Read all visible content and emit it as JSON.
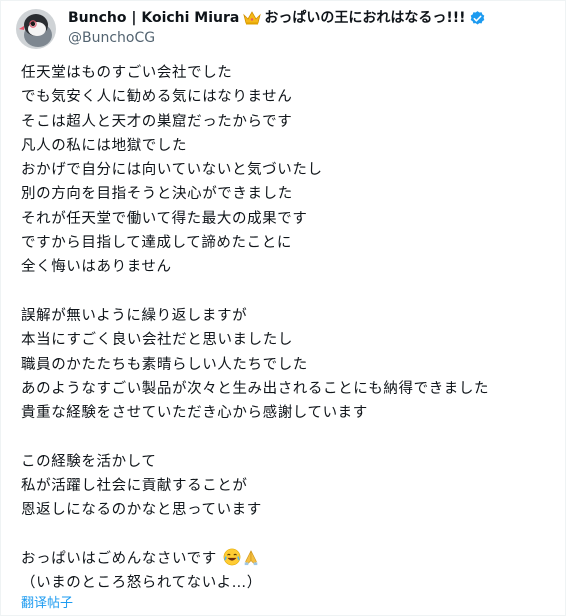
{
  "author": {
    "display_name_prefix": "Buncho | Koichi Miura",
    "display_name_suffix": "おっぱいの王におれはなるっ!!!",
    "crown_icon": "crown-emoji",
    "verified_icon": "verified-badge-icon",
    "handle": "@BunchoCG"
  },
  "colors": {
    "text": "#0f1419",
    "muted": "#536471",
    "link": "#1d9bf0"
  },
  "post": {
    "paragraphs": [
      [
        "任天堂はものすごい会社でした",
        "でも気安く人に勧める気にはなりません",
        "そこは超人と天才の巣窟だったからです",
        "凡人の私には地獄でした",
        "おかげで自分には向いていないと気づいたし",
        "別の方向を目指そうと決心ができました",
        "それが任天堂で働いて得た最大の成果です",
        "ですから目指して達成して諦めたことに",
        "全く悔いはありません"
      ],
      [
        "誤解が無いように繰り返しますが",
        "本当にすごく良い会社だと思いましたし",
        "職員のかたたちも素晴らしい人たちでした",
        "あのようなすごい製品が次々と生み出されることにも納得できました",
        "貴重な経験をさせていただき心から感謝しています"
      ],
      [
        "この経験を活かして",
        "私が活躍し社会に貢献することが",
        "恩返しになるのかなと思っています"
      ]
    ],
    "closing_line": "おっぱいはごめんなさいです",
    "closing_emojis": [
      "laughing-tears-emoji",
      "folded-hands-emoji"
    ],
    "final_line": "（いまのところ怒られてないよ…）"
  },
  "translate_label": "翻译帖子"
}
